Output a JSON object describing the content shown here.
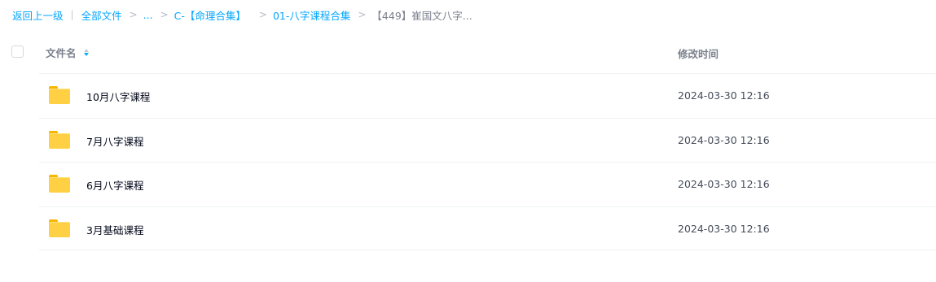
{
  "breadcrumb": {
    "back": "返回上一级",
    "pipe": "|",
    "all_files": "全部文件",
    "sep": ">",
    "ellipsis": "...",
    "level1": "C-【命理合集】",
    "level2": "01-八字课程合集",
    "current": "【449】崔国文八字..."
  },
  "table": {
    "col_name": "文件名",
    "col_time": "修改时间",
    "rows": [
      {
        "icon": "folder-icon",
        "name": "10月八字课程",
        "time": "2024-03-30 12:16"
      },
      {
        "icon": "folder-icon",
        "name": "7月八字课程",
        "time": "2024-03-30 12:16"
      },
      {
        "icon": "folder-icon",
        "name": "6月八字课程",
        "time": "2024-03-30 12:16"
      },
      {
        "icon": "folder-icon",
        "name": "3月基础课程",
        "time": "2024-03-30 12:16"
      }
    ]
  },
  "colors": {
    "link": "#06a7ff",
    "folder": "#ffd044",
    "muted_text": "#7b818d"
  }
}
